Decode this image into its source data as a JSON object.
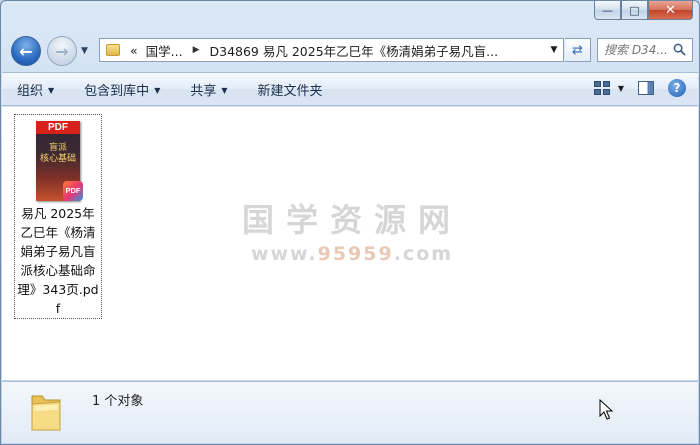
{
  "window": {
    "caption": {
      "minimize": "—",
      "maximize": "□",
      "close": "✕"
    }
  },
  "nav": {
    "back_icon": "back-arrow-icon",
    "forward_icon": "forward-arrow-icon",
    "history_dropdown": "▼"
  },
  "address": {
    "overflow": "«",
    "crumbs": [
      "国学...",
      "D34869 易凡 2025年乙巳年《杨清娟弟子易凡盲..."
    ],
    "dropdown": "▼",
    "refresh_icon": "refresh-icon"
  },
  "search": {
    "placeholder": "搜索 D34..."
  },
  "commands": {
    "organize": "组织",
    "include_library": "包含到库中",
    "share": "共享",
    "new_folder": "新建文件夹",
    "arrow": "▼"
  },
  "file": {
    "thumb_label": "PDF",
    "thumb_title": "盲派\n核心基础",
    "badge": "PDF",
    "name": "易凡 2025年乙巳年《杨清娟弟子易凡盲派核心基础命理》343页.pdf"
  },
  "watermark": {
    "title": "国学资源网",
    "url_digits": "95959",
    "url_prefix": "www.",
    "url_suffix": ".com"
  },
  "status": {
    "count_text": "1 个对象"
  },
  "colors": {
    "accent": "#2a6bc2",
    "close": "#c2442a",
    "pdf_red": "#d7221c"
  }
}
